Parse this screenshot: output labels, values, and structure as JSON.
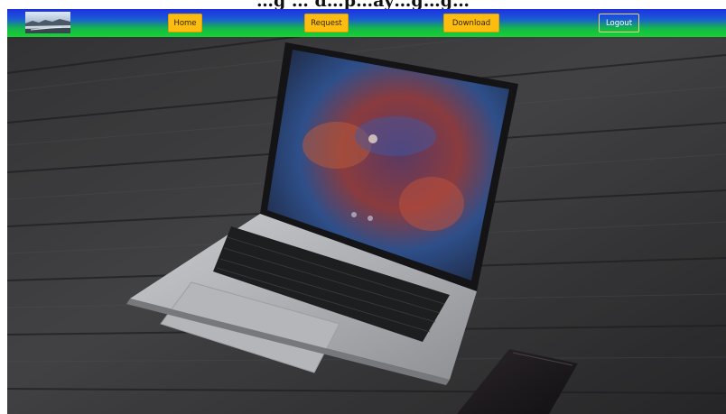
{
  "page": {
    "title": "…g … d…p…ay…g…g…"
  },
  "navbar": {
    "logo_icon": "landscape-logo-icon",
    "buttons": [
      {
        "label": "Home"
      },
      {
        "label": "Request"
      },
      {
        "label": "Download"
      },
      {
        "label": "Logout"
      }
    ],
    "colors": {
      "gradient_top": "#1f2fe0",
      "gradient_bottom": "#17d32f",
      "button_fill": "#fdbd10"
    }
  },
  "hero": {
    "image_icon": "laptop-on-wooden-floor-photo"
  }
}
